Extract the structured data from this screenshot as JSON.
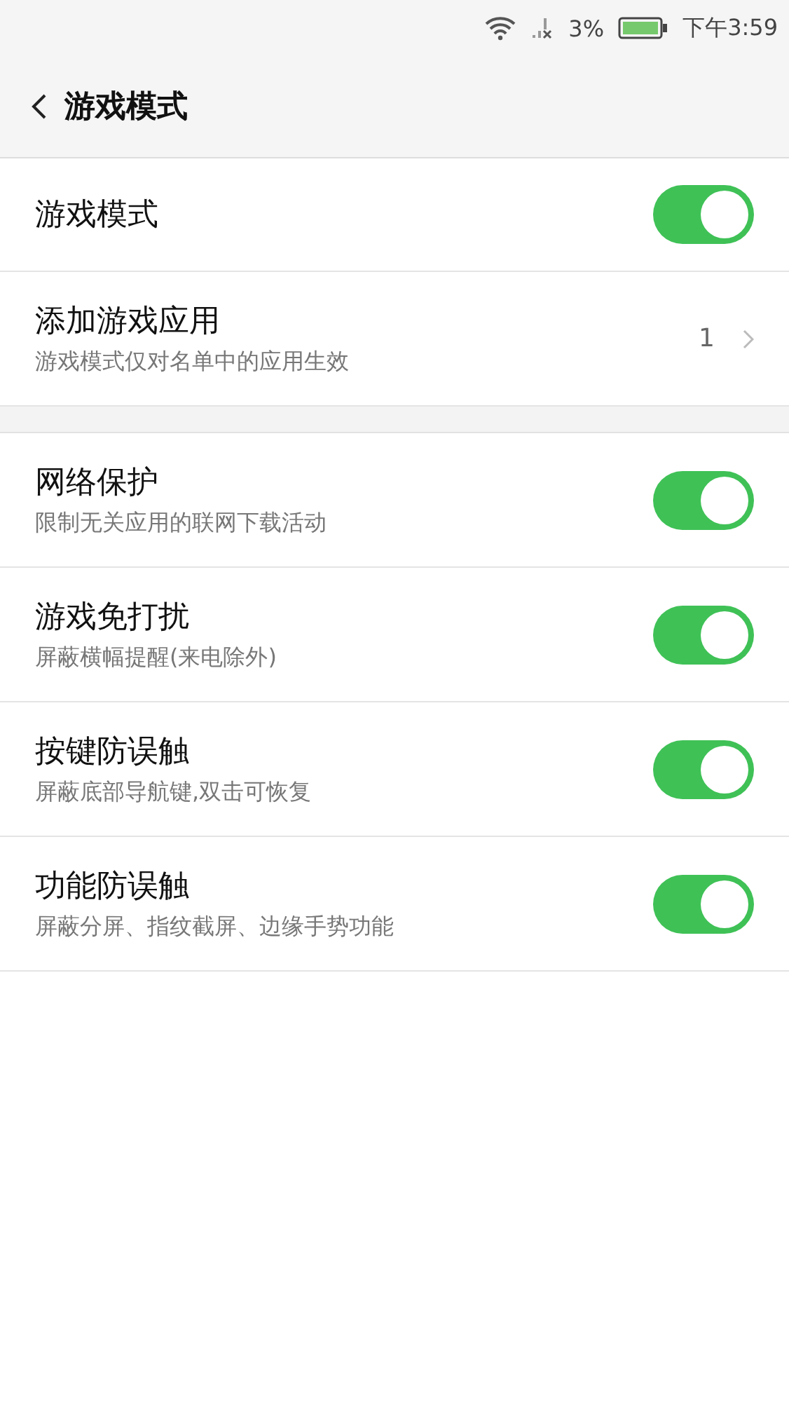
{
  "status_bar": {
    "battery": "3%",
    "time": "下午3:59"
  },
  "header": {
    "title": "游戏模式"
  },
  "sections": [
    {
      "items": [
        {
          "kind": "toggle",
          "title": "游戏模式",
          "on": true
        },
        {
          "kind": "link",
          "title": "添加游戏应用",
          "subtitle": "游戏模式仅对名单中的应用生效",
          "value": "1"
        }
      ]
    },
    {
      "items": [
        {
          "kind": "toggle",
          "title": "网络保护",
          "subtitle": "限制无关应用的联网下载活动",
          "on": true
        },
        {
          "kind": "toggle",
          "title": "游戏免打扰",
          "subtitle": "屏蔽横幅提醒(来电除外)",
          "on": true
        },
        {
          "kind": "toggle",
          "title": "按键防误触",
          "subtitle": "屏蔽底部导航键,双击可恢复",
          "on": true
        },
        {
          "kind": "toggle",
          "title": "功能防误触",
          "subtitle": "屏蔽分屏、指纹截屏、边缘手势功能",
          "on": true
        }
      ]
    }
  ]
}
